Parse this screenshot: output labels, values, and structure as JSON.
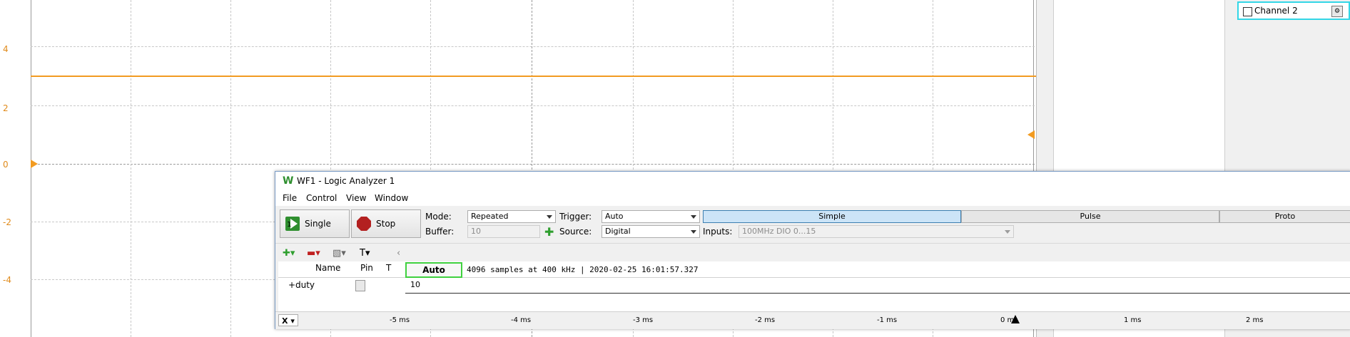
{
  "scope": {
    "y_labels": [
      "4",
      "2",
      "0",
      "-2",
      "-4"
    ],
    "channel_label": "Channel 2",
    "channel_button_icon": "settings-icon"
  },
  "window": {
    "title": "WF1 - Logic Analyzer 1",
    "logo_icon": "waveforms-logo-icon",
    "menu": [
      "File",
      "Control",
      "View",
      "Window"
    ],
    "single_label": "Single",
    "stop_label": "Stop",
    "mode_label": "Mode:",
    "mode_value": "Repeated",
    "buffer_label": "Buffer:",
    "buffer_value": "10",
    "trigger_label": "Trigger:",
    "trigger_value": "Auto",
    "source_label": "Source:",
    "source_value": "Digital",
    "inputs_label": "Inputs:",
    "inputs_value": "100MHz DIO 0...15",
    "tabs": [
      "Simple",
      "Pulse",
      "Proto"
    ],
    "headers": {
      "name": "Name",
      "pin": "Pin",
      "t": "T"
    },
    "auto_label": "Auto",
    "info": "4096 samples at 400 kHz | 2020-02-25 16:01:57.327",
    "row_name": "duty",
    "row_value": "10",
    "x_label": "X",
    "ticks": [
      "-5 ms",
      "-4 ms",
      "-3 ms",
      "-2 ms",
      "-1 ms",
      "0 ms",
      "1 ms",
      "2 ms"
    ],
    "colors": {
      "signal": "#f29b21",
      "auto_border": "#3fd13f",
      "channel_border": "#33d6e6",
      "active_tab": "#cce4f7"
    }
  }
}
